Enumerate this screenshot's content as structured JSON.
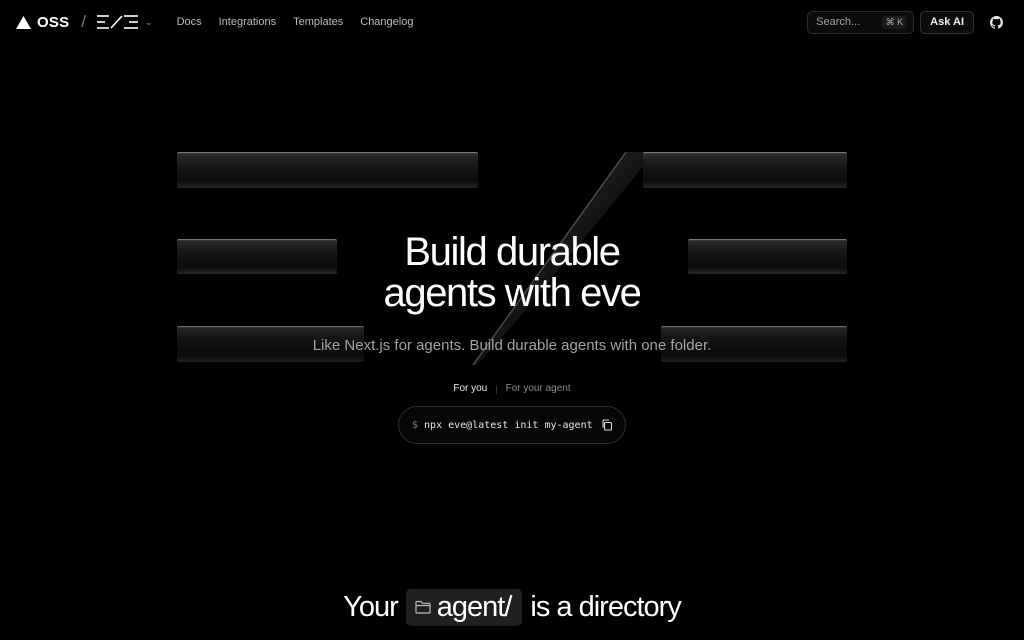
{
  "header": {
    "brand": "OSS",
    "nav": [
      {
        "label": "Docs"
      },
      {
        "label": "Integrations"
      },
      {
        "label": "Templates"
      },
      {
        "label": "Changelog"
      }
    ],
    "search_placeholder": "Search...",
    "search_shortcut": "⌘ K",
    "ask_ai": "Ask AI",
    "github_icon": "github-icon"
  },
  "hero": {
    "title_line1": "Build durable",
    "title_line2": "agents with eve",
    "subtitle": "Like Next.js for agents. Build durable agents with one folder.",
    "tabs": [
      {
        "label": "For you",
        "active": true
      },
      {
        "label": "For your agent",
        "active": false
      }
    ],
    "command_prompt": "$",
    "command": "npx eve@latest init my-agent"
  },
  "directory": {
    "prefix": "Your",
    "folder": "agent/",
    "suffix": "is a directory"
  }
}
